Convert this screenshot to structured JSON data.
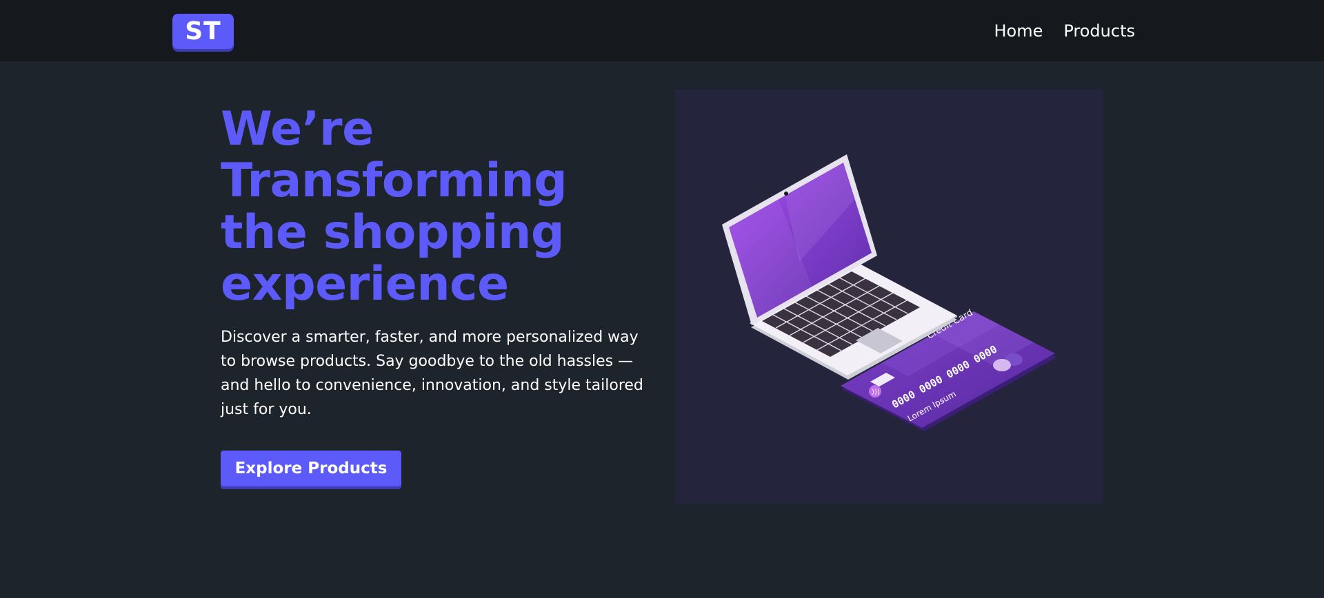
{
  "header": {
    "logo_text": "ST",
    "nav": [
      {
        "label": "Home"
      },
      {
        "label": "Products"
      }
    ]
  },
  "hero": {
    "title": "We’re Transforming the shopping experience",
    "description": "Discover a smarter, faster, and more personalized way to browse products. Say goodbye to the old hassles — and hello to convenience, innovation, and style tailored just for you.",
    "cta_label": "Explore Products"
  },
  "illustration": {
    "card_title": "Credit Card",
    "card_number": "0000 0000 0000 0000",
    "card_holder": "Lorem Ipsum"
  },
  "colors": {
    "accent": "#5d5afa",
    "background": "#1e242c",
    "navbar": "#15181d",
    "illustration_bg": "#25243d"
  }
}
